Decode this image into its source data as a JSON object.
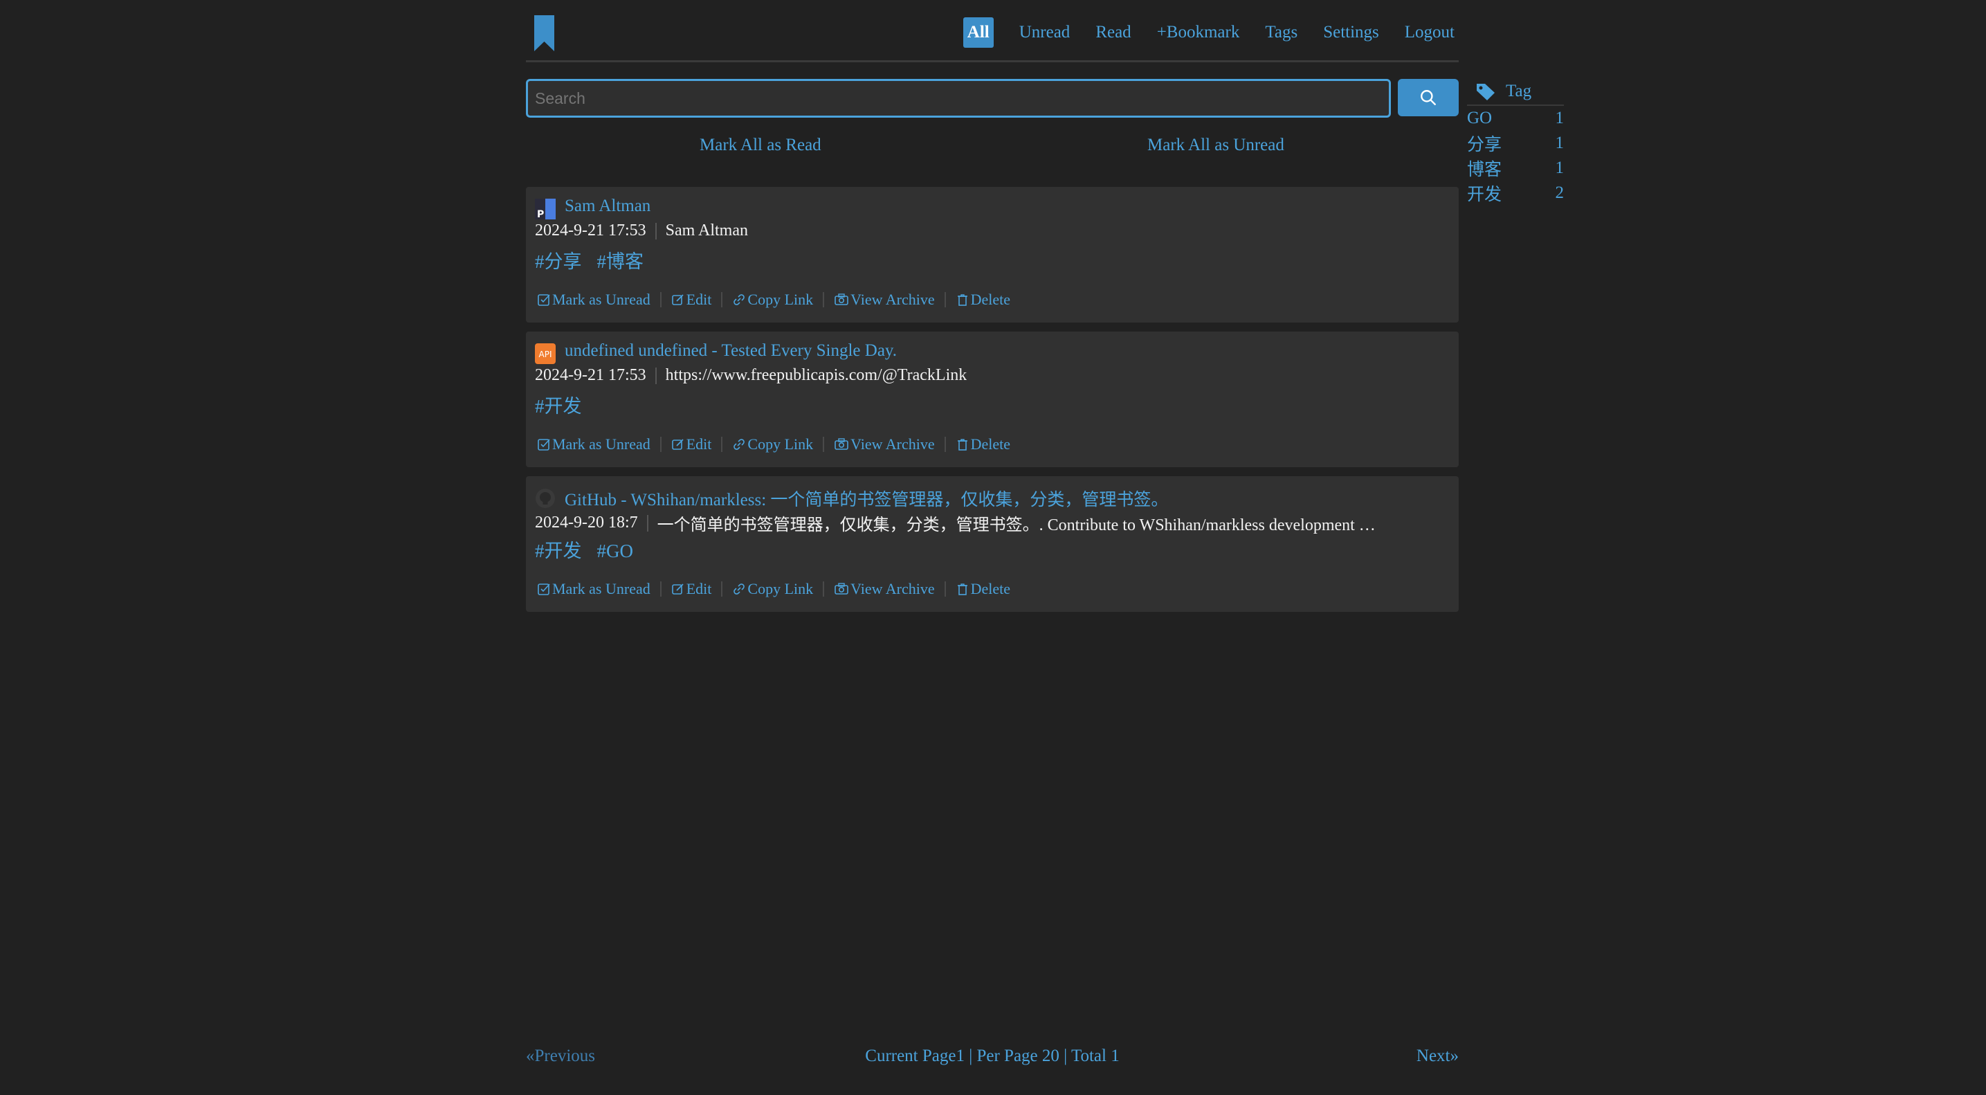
{
  "nav": {
    "items": [
      "All",
      "Unread",
      "Read",
      "+Bookmark",
      "Tags",
      "Settings",
      "Logout"
    ],
    "active": "All"
  },
  "search": {
    "placeholder": "Search",
    "value": ""
  },
  "mark": {
    "all_read": "Mark All as Read",
    "all_unread": "Mark All as Unread"
  },
  "bookmarks": [
    {
      "title": "Sam Altman",
      "date": "2024-9-21 17:53",
      "desc": "Sam Altman",
      "tags": [
        "#分享",
        "#博客"
      ],
      "favicon": "p-icon",
      "actions": [
        "Mark as Unread",
        "Edit",
        "Copy Link",
        "View Archive",
        "Delete"
      ]
    },
    {
      "title": "undefined undefined - Tested Every Single Day.",
      "date": "2024-9-21 17:53",
      "desc": "https://www.freepublicapis.com/@TrackLink",
      "tags": [
        "#开发"
      ],
      "favicon": "api-icon",
      "favicon_text": "API",
      "actions": [
        "Mark as Unread",
        "Edit",
        "Copy Link",
        "View Archive",
        "Delete"
      ]
    },
    {
      "title": "GitHub - WShihan/markless: 一个简单的书签管理器，仅收集，分类，管理书签。",
      "date": "2024-9-20 18:7",
      "desc": "一个简单的书签管理器，仅收集，分类，管理书签。. Contribute to WShihan/markless development …",
      "tags": [
        "#开发",
        "#GO"
      ],
      "favicon": "github-icon",
      "actions": [
        "Mark as Unread",
        "Edit",
        "Copy Link",
        "View Archive",
        "Delete"
      ]
    }
  ],
  "tag_sidebar": {
    "heading": "Tag",
    "tags": [
      {
        "name": "GO",
        "count": "1"
      },
      {
        "name": "分享",
        "count": "1"
      },
      {
        "name": "博客",
        "count": "1"
      },
      {
        "name": "开发",
        "count": "2"
      }
    ]
  },
  "pagination": {
    "prev": "«Previous",
    "info": "Current Page1 | Per Page 20 | Total 1",
    "next": "Next»"
  },
  "colors": {
    "accent": "#4ba3dc",
    "background": "#212121",
    "card": "#313131"
  }
}
